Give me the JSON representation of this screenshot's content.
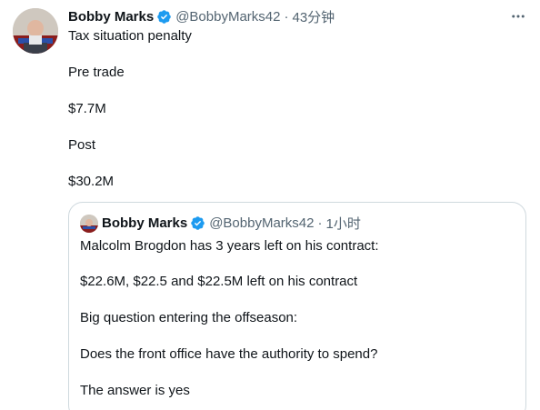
{
  "tweet": {
    "author_name": "Bobby Marks",
    "handle": "@BobbyMarks42",
    "separator": "·",
    "time": "43分钟",
    "lines": [
      "Tax situation penalty",
      "Pre trade",
      "$7.7M",
      "Post",
      "$30.2M"
    ]
  },
  "quoted_tweet": {
    "author_name": "Bobby Marks",
    "handle": "@BobbyMarks42",
    "separator": "·",
    "time": "1小时",
    "lines": [
      "Malcolm Brogdon has 3 years left on his contract:",
      "$22.6M, $22.5 and $22.5M left on his contract",
      "Big question entering the offseason:",
      "Does the front office have the authority to spend?",
      "The answer is yes"
    ]
  },
  "colors": {
    "verified_blue": "#1d9bf0",
    "secondary_text": "#536471",
    "border": "#cfd9de"
  },
  "icons": {
    "verified": "verified-badge-icon",
    "more": "more-options-icon"
  }
}
